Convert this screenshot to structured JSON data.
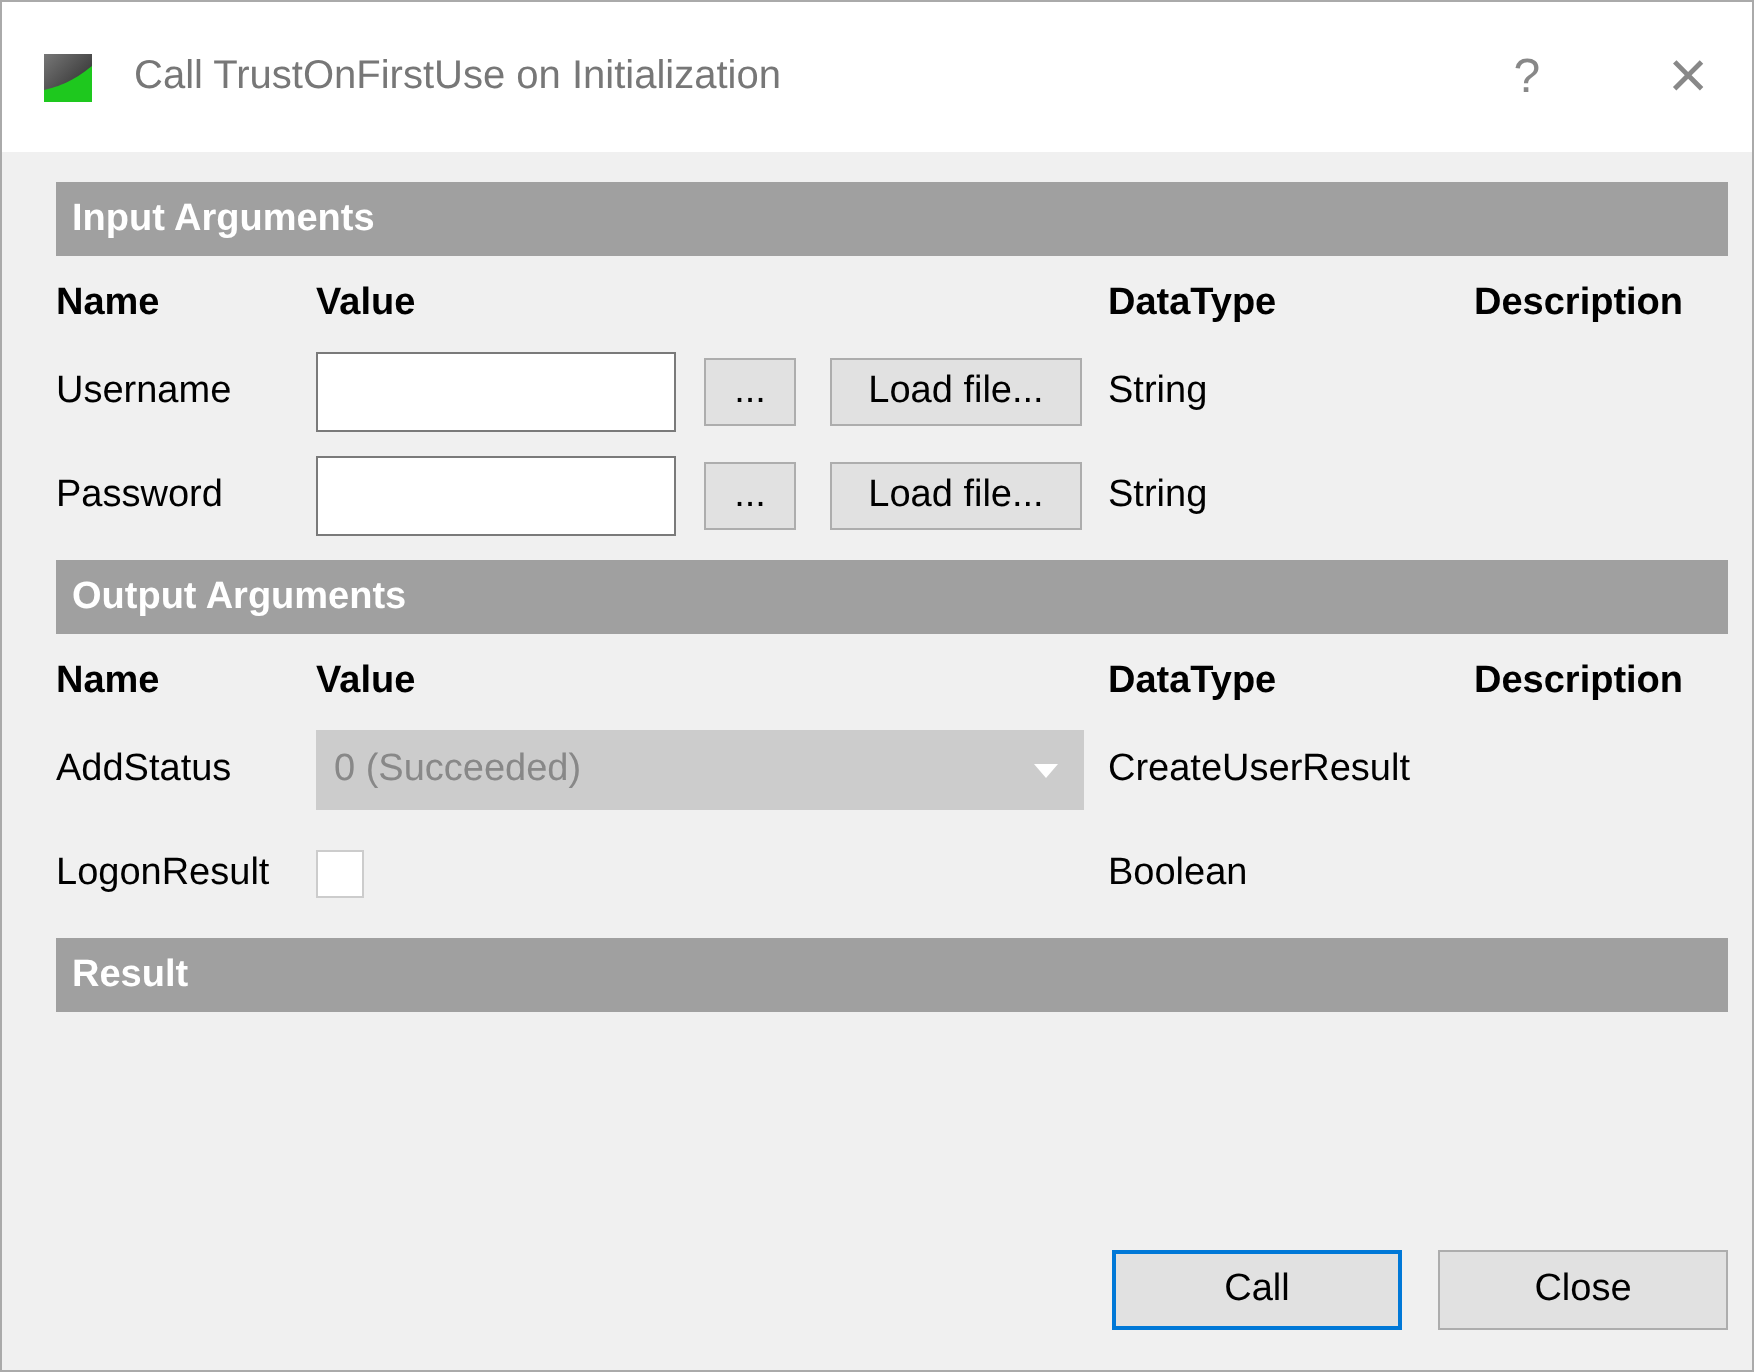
{
  "window": {
    "title": "Call TrustOnFirstUse on Initialization",
    "help": "?",
    "close": "×"
  },
  "sections": [
    {
      "title": "Input Arguments",
      "columns": [
        "Name",
        "Value",
        "DataType",
        "Description"
      ],
      "rows": [
        {
          "kind": "text_input",
          "name": "Username",
          "value": "",
          "browse": "...",
          "load": "Load file...",
          "datatype": "String"
        },
        {
          "kind": "text_input",
          "name": "Password",
          "value": "",
          "browse": "...",
          "load": "Load file...",
          "datatype": "String"
        }
      ]
    },
    {
      "title": "Output Arguments",
      "columns": [
        "Name",
        "Value",
        "DataType",
        "Description"
      ],
      "rows": [
        {
          "kind": "dropdown",
          "name": "AddStatus",
          "value": "0 (Succeeded)",
          "disabled": true,
          "datatype": "CreateUserResult"
        },
        {
          "kind": "checkbox",
          "name": "LogonResult",
          "checked": false,
          "datatype": "Boolean"
        }
      ]
    },
    {
      "title": "Result"
    }
  ],
  "buttons": [
    {
      "label": "Call",
      "default": true
    },
    {
      "label": "Close",
      "default": false
    }
  ]
}
